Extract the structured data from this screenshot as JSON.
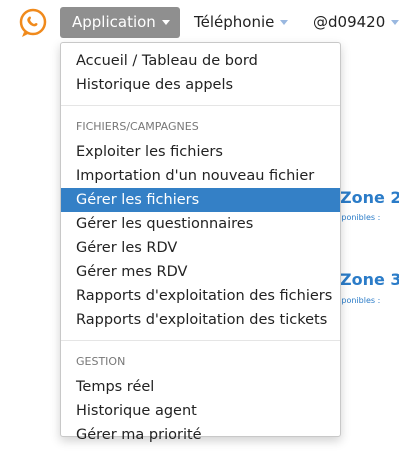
{
  "navbar": {
    "logo_icon": "chat-phone-logo",
    "application_label": "Application",
    "telephonie_label": "Téléphonie",
    "user_label": "@d09420"
  },
  "background": {
    "zone2_title": "Zone 2",
    "zone2_sub": "isponibles :",
    "zone3_title": "Zone 3",
    "zone3_sub": "isponibles :"
  },
  "dropdown": {
    "group1": [
      "Accueil / Tableau de bord",
      "Historique des appels"
    ],
    "header2": "FICHIERS/CAMPAGNES",
    "group2": [
      "Exploiter les fichiers",
      "Importation d'un nouveau fichier",
      "Gérer les fichiers",
      "Gérer les questionnaires",
      "Gérer les RDV",
      "Gérer mes RDV",
      "Rapports d'exploitation des fichiers",
      "Rapports d'exploitation des tickets"
    ],
    "header3": "GESTION",
    "group3": [
      "Temps réel",
      "Historique agent",
      "Gérer ma priorité"
    ],
    "active_item": "Gérer les fichiers"
  },
  "colors": {
    "active_bg": "#3480c6",
    "logo": "#f08a1c",
    "zone_text": "#2b7cc8",
    "app_button_bg": "#8f8f8f"
  }
}
